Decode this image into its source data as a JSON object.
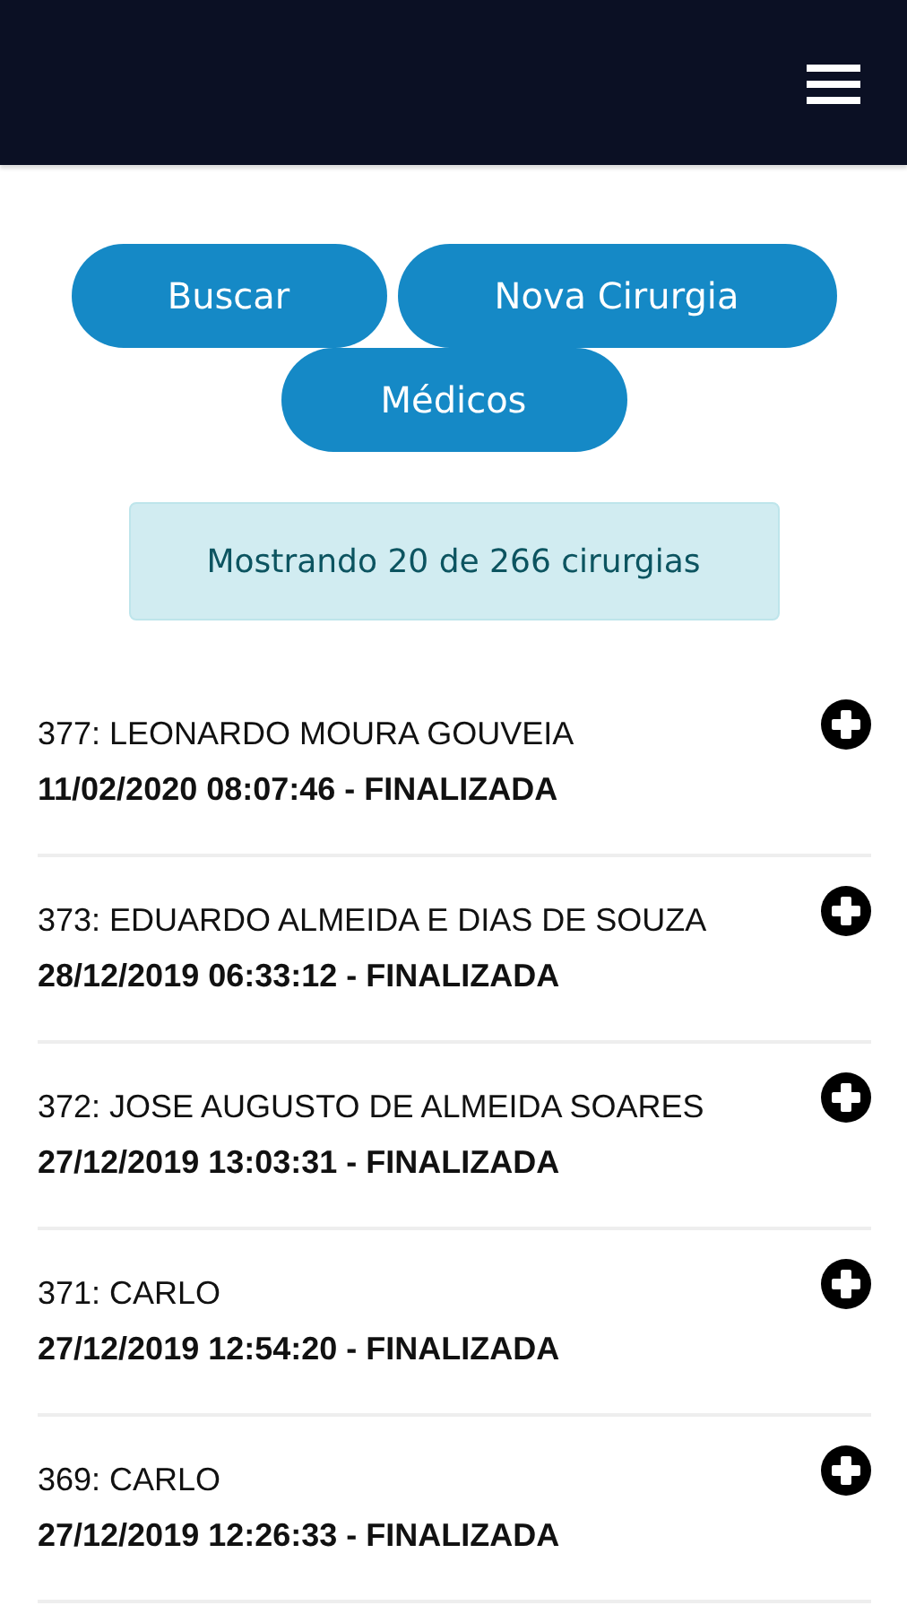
{
  "buttons": [
    {
      "label": "Buscar"
    },
    {
      "label": "Nova Cirurgia"
    },
    {
      "label": "Médicos"
    }
  ],
  "alert": "Mostrando 20 de 266 cirurgias",
  "surgeries": [
    {
      "title": "377: LEONARDO MOURA GOUVEIA",
      "detail": "11/02/2020 08:07:46 - FINALIZADA"
    },
    {
      "title": "373: EDUARDO ALMEIDA E DIAS DE SOUZA",
      "detail": "28/12/2019 06:33:12 - FINALIZADA"
    },
    {
      "title": "372: JOSE AUGUSTO DE ALMEIDA SOARES",
      "detail": "27/12/2019 13:03:31 - FINALIZADA"
    },
    {
      "title": "371: CARLO",
      "detail": "27/12/2019 12:54:20 - FINALIZADA"
    },
    {
      "title": "369: CARLO",
      "detail": "27/12/2019 12:26:33 - FINALIZADA"
    }
  ]
}
